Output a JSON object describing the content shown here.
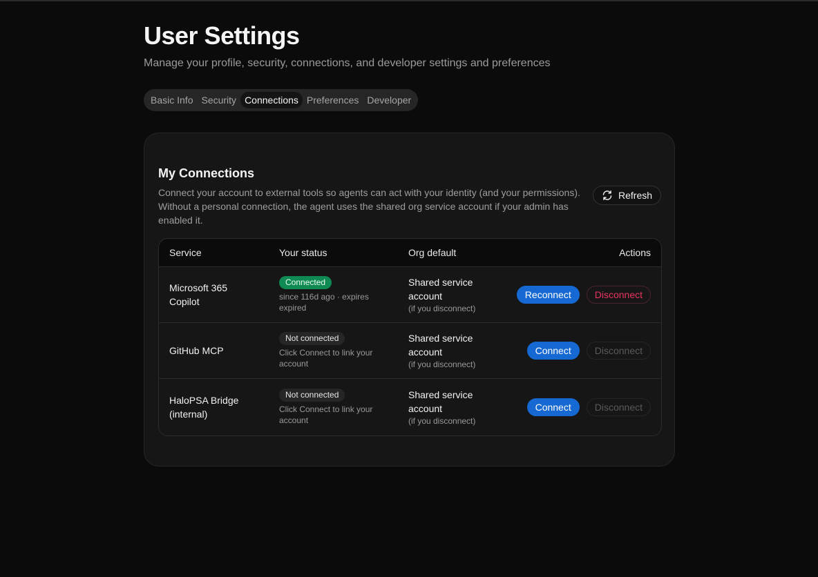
{
  "page": {
    "title": "User Settings",
    "subtitle": "Manage your profile, security, connections, and developer settings and preferences"
  },
  "tabs": [
    {
      "label": "Basic Info",
      "active": false
    },
    {
      "label": "Security",
      "active": false
    },
    {
      "label": "Connections",
      "active": true
    },
    {
      "label": "Preferences",
      "active": false
    },
    {
      "label": "Developer",
      "active": false
    }
  ],
  "connections": {
    "title": "My Connections",
    "description": "Connect your account to external tools so agents can act with your identity (and your permissions). Without a personal connection, the agent uses the shared org service account if your admin has enabled it.",
    "refresh_label": "Refresh",
    "refresh_icon": "refresh-icon",
    "columns": {
      "service": "Service",
      "status": "Your status",
      "org_default": "Org default",
      "actions": "Actions"
    },
    "rows": [
      {
        "service": "Microsoft 365 Copilot",
        "status_badge": "Connected",
        "status_note": "since 116d ago · expires expired",
        "org_default": "Shared service account",
        "org_note": "(if you disconnect)",
        "primary_action": "Reconnect",
        "secondary_action": "Disconnect"
      },
      {
        "service": "GitHub MCP",
        "status_badge": "Not connected",
        "status_note": "Click Connect to link your account",
        "org_default": "Shared service account",
        "org_note": "(if you disconnect)",
        "primary_action": "Connect",
        "secondary_action": "Disconnect"
      },
      {
        "service": "HaloPSA Bridge (internal)",
        "status_badge": "Not connected",
        "status_note": "Click Connect to link your account",
        "org_default": "Shared service account",
        "org_note": "(if you disconnect)",
        "primary_action": "Connect",
        "secondary_action": "Disconnect"
      }
    ]
  },
  "colors": {
    "background": "#0b0b0b",
    "card": "#161616",
    "primary": "#1669d3",
    "connected": "#0f8a52",
    "danger": "#e8345f"
  }
}
